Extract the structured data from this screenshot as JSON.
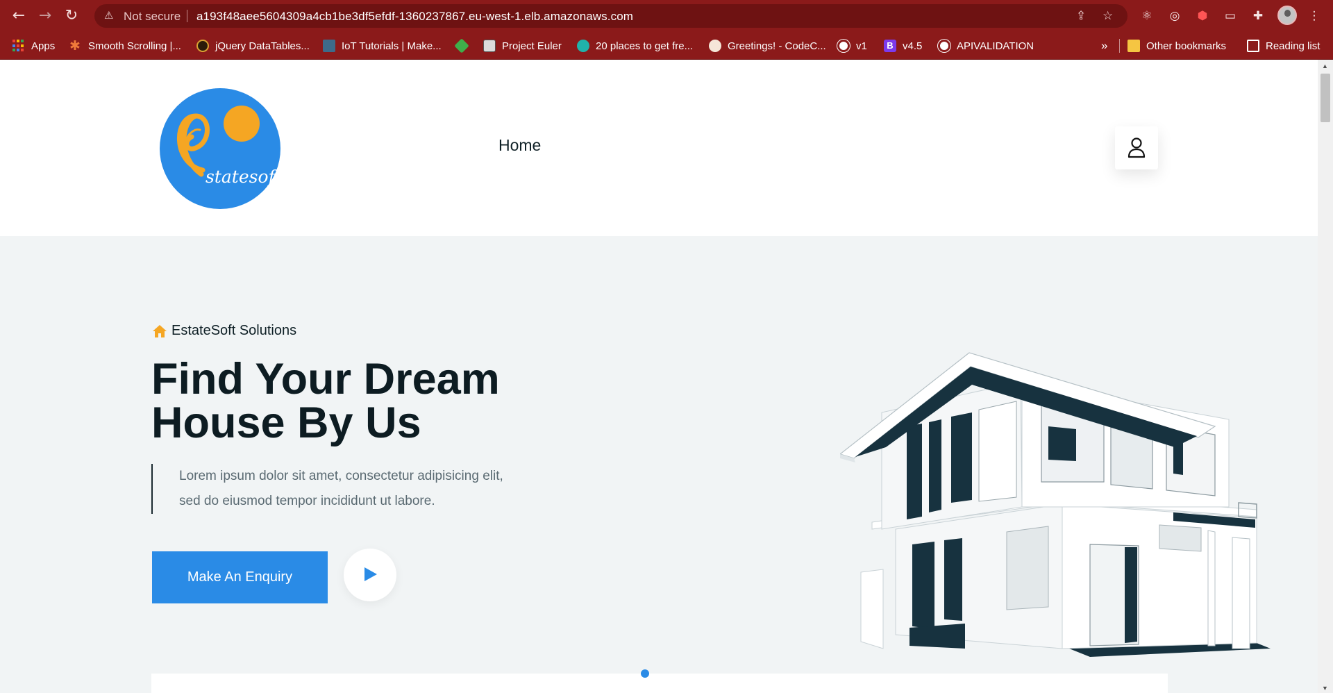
{
  "browser": {
    "nav": {
      "back_icon": "back-arrow-icon",
      "forward_icon": "forward-arrow-icon",
      "reload_icon": "reload-icon"
    },
    "omnibox": {
      "security_label": "Not secure",
      "url": "a193f48aee5604309a4cb1be3df5efdf-1360237867.eu-west-1.elb.amazonaws.com"
    },
    "toolbar_icons": [
      "share-icon",
      "star-icon",
      "react-devtools-icon",
      "target-icon",
      "shield-icon",
      "cast-icon",
      "puzzle-icon",
      "avatar",
      "menu-icon"
    ],
    "bookmarks": [
      {
        "label": "Apps",
        "icon": "apps-grid-icon"
      },
      {
        "label": "Smooth Scrolling |...",
        "icon": "asterisk-icon",
        "color": "#f07a3a"
      },
      {
        "label": "jQuery DataTables...",
        "icon": "jquery-icon",
        "color": "#d9a233"
      },
      {
        "label": "IoT Tutorials | Make...",
        "icon": "robot-icon",
        "color": "#3d6b8a"
      },
      {
        "label": "",
        "icon": "cube-icon",
        "color": "#3fae4a"
      },
      {
        "label": "Project Euler",
        "icon": "euler-icon",
        "color": "#dcdcdc"
      },
      {
        "label": "20 places to get fre...",
        "icon": "bubble-icon",
        "color": "#20b2aa"
      },
      {
        "label": "Greetings! - CodeC...",
        "icon": "cookie-icon",
        "color": "#f5e6d8"
      },
      {
        "label": "v1",
        "icon": "globe-icon",
        "color": "#ffffff"
      },
      {
        "label": "v4.5",
        "icon": "bootstrap-icon",
        "color": "#7c3aed"
      },
      {
        "label": "APIVALIDATION",
        "icon": "globe-icon",
        "color": "#ffffff"
      }
    ],
    "overflow_label": "»",
    "other_bookmarks": "Other bookmarks",
    "reading_list": "Reading list"
  },
  "site": {
    "logo_text": "statesoft",
    "nav": {
      "home": "Home"
    },
    "user_icon": "user-icon"
  },
  "hero": {
    "eyebrow": "EstateSoft Solutions",
    "title_line1": "Find Your Dream",
    "title_line2": "House By Us",
    "description_line1": "Lorem ipsum dolor sit amet, consectetur adipisicing elit,",
    "description_line2": "sed do eiusmod tempor incididunt ut labore.",
    "cta_label": "Make An Enquiry",
    "play_icon": "play-icon"
  },
  "colors": {
    "browser_chrome": "#8b1a1a",
    "accent": "#2a8be6",
    "logo_circle": "#2a8be6",
    "logo_sun": "#f5a623",
    "eyebrow_icon": "#f5a623",
    "heading": "#0d1c22",
    "hero_bg": "#f1f4f5"
  }
}
